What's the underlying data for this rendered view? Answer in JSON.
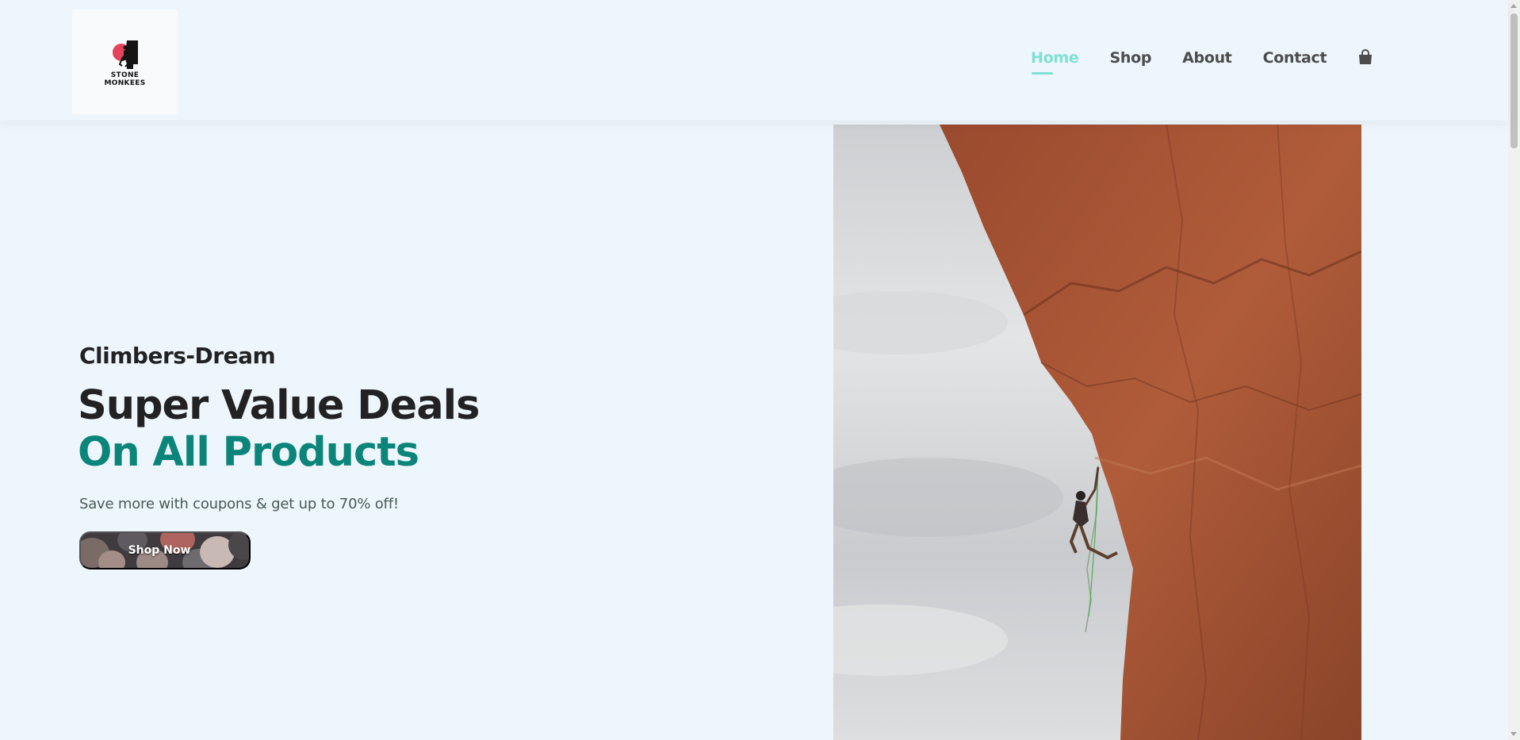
{
  "brand": {
    "logo_text_line1": "STONE",
    "logo_text_line2": "MONKEES",
    "accent_color": "#e4435b"
  },
  "nav": {
    "items": [
      {
        "label": "Home",
        "active": true
      },
      {
        "label": "Shop",
        "active": false
      },
      {
        "label": "About",
        "active": false
      },
      {
        "label": "Contact",
        "active": false
      }
    ],
    "cart_icon": "shopping-bag-icon",
    "active_color": "#7fe0d3"
  },
  "hero": {
    "subtitle": "Climbers-Dream",
    "title_line1": "Super Value Deals",
    "title_line2": "On All Products",
    "description": "Save more with coupons & get up to 70% off!",
    "button_label": "Shop Now",
    "highlight_color": "#0b8579"
  }
}
